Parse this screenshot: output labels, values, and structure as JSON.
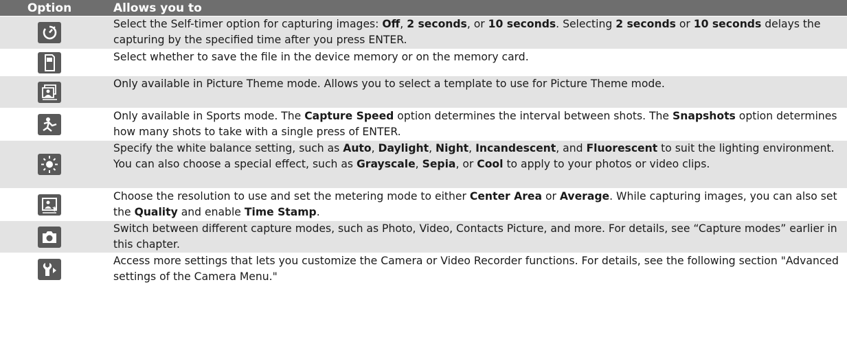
{
  "header": {
    "option_label": "Option",
    "allows_label": "Allows you to"
  },
  "rows": [
    {
      "icon": "self-timer-icon",
      "segments": [
        {
          "t": "Select the Self-timer option for capturing images: "
        },
        {
          "t": "Off",
          "b": true
        },
        {
          "t": ", "
        },
        {
          "t": "2 seconds",
          "b": true
        },
        {
          "t": ", or "
        },
        {
          "t": "10 seconds",
          "b": true
        },
        {
          "t": ". Selecting "
        },
        {
          "t": "2 seconds",
          "b": true
        },
        {
          "t": " or "
        },
        {
          "t": "10 seconds",
          "b": true
        },
        {
          "t": " delays the capturing by the specified time after you press ENTER."
        }
      ]
    },
    {
      "icon": "storage-card-icon",
      "segments": [
        {
          "t": "Select whether to save the file in the device memory or on the memory card."
        }
      ]
    },
    {
      "icon": "picture-theme-icon",
      "segments": [
        {
          "t": "Only available in Picture Theme mode. Allows you to select a template to use for Picture Theme mode."
        }
      ]
    },
    {
      "icon": "sports-mode-icon",
      "segments": [
        {
          "t": "Only available in Sports mode. The "
        },
        {
          "t": "Capture Speed",
          "b": true
        },
        {
          "t": " option determines the interval between shots. The "
        },
        {
          "t": "Snapshots",
          "b": true
        },
        {
          "t": " option determines how many shots to take with a single press of ENTER."
        }
      ]
    },
    {
      "icon": "white-balance-icon",
      "segments": [
        {
          "t": "Specify the white balance setting, such as "
        },
        {
          "t": "Auto",
          "b": true
        },
        {
          "t": ", "
        },
        {
          "t": "Daylight",
          "b": true
        },
        {
          "t": ", "
        },
        {
          "t": "Night",
          "b": true
        },
        {
          "t": ", "
        },
        {
          "t": "Incandescent",
          "b": true
        },
        {
          "t": ", and "
        },
        {
          "t": "Fluorescent",
          "b": true
        },
        {
          "t": " to suit the lighting environment. You can also choose a special effect, such as "
        },
        {
          "t": "Grayscale",
          "b": true
        },
        {
          "t": ", "
        },
        {
          "t": "Sepia",
          "b": true
        },
        {
          "t": ", or "
        },
        {
          "t": "Cool",
          "b": true
        },
        {
          "t": " to apply to your photos or video clips."
        }
      ]
    },
    {
      "icon": "resolution-settings-icon",
      "segments": [
        {
          "t": "Choose the resolution to use and set the metering mode to either "
        },
        {
          "t": "Center Area",
          "b": true
        },
        {
          "t": " or "
        },
        {
          "t": "Average",
          "b": true
        },
        {
          "t": ". While capturing images, you can also set the "
        },
        {
          "t": "Quality",
          "b": true
        },
        {
          "t": " and enable "
        },
        {
          "t": "Time Stamp",
          "b": true
        },
        {
          "t": "."
        }
      ]
    },
    {
      "icon": "camera-mode-icon",
      "segments": [
        {
          "t": "Switch between different capture modes, such as Photo, Video, Contacts Picture, and more. For details, see “Capture modes” earlier in this chapter."
        }
      ]
    },
    {
      "icon": "advanced-settings-icon",
      "segments": [
        {
          "t": "Access more settings that lets you customize the Camera or Video Recorder functions. For details, see the following section \"Advanced settings of the Camera Menu.\""
        }
      ]
    }
  ]
}
